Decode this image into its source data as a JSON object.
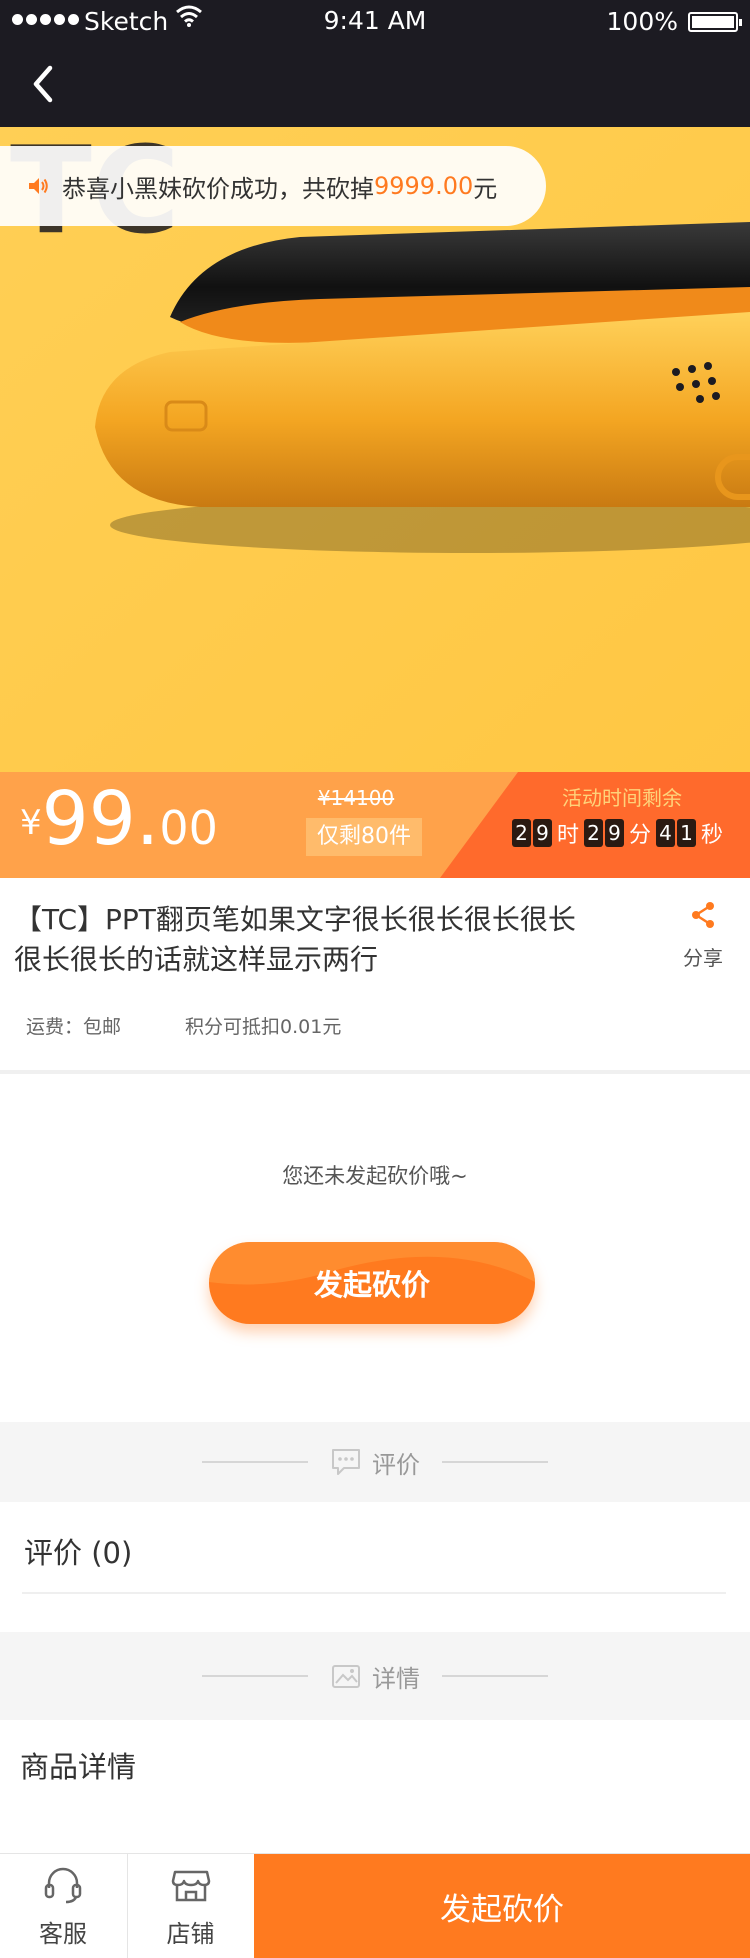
{
  "status_bar": {
    "carrier": "Sketch",
    "time": "9:41 AM",
    "battery": "100%"
  },
  "toast": {
    "prefix": "恭喜小黑妹砍价成功，共砍掉 ",
    "amount": "9999.00",
    "suffix": "元"
  },
  "price": {
    "currency": "¥",
    "integer": "99.",
    "decimal": "00",
    "original": "¥14100",
    "stock": "仅剩80件"
  },
  "countdown": {
    "title": "活动时间剩余",
    "hours": [
      "2",
      "9"
    ],
    "hours_unit": "时",
    "minutes": [
      "2",
      "9"
    ],
    "minutes_unit": "分",
    "seconds": [
      "4",
      "1"
    ],
    "seconds_unit": "秒"
  },
  "product": {
    "title": "【TC】PPT翻页笔如果文字很长很长很长很长很长很长的话就这样显示两行",
    "share_label": "分享",
    "shipping": "运费：包邮",
    "points": "积分可抵扣0.01元"
  },
  "bargain": {
    "hint": "您还未发起砍价哦~",
    "button": "发起砍价"
  },
  "sections": {
    "review_header": "评价",
    "review_title": "评价 (0)",
    "detail_header": "详情",
    "detail_title": "商品详情"
  },
  "bottom_bar": {
    "service": "客服",
    "store": "店铺",
    "cta": "发起砍价"
  },
  "colors": {
    "accent": "#ff7a1f",
    "hero_bg": "#ffcc4d",
    "top_bar": "#1c1b22"
  }
}
